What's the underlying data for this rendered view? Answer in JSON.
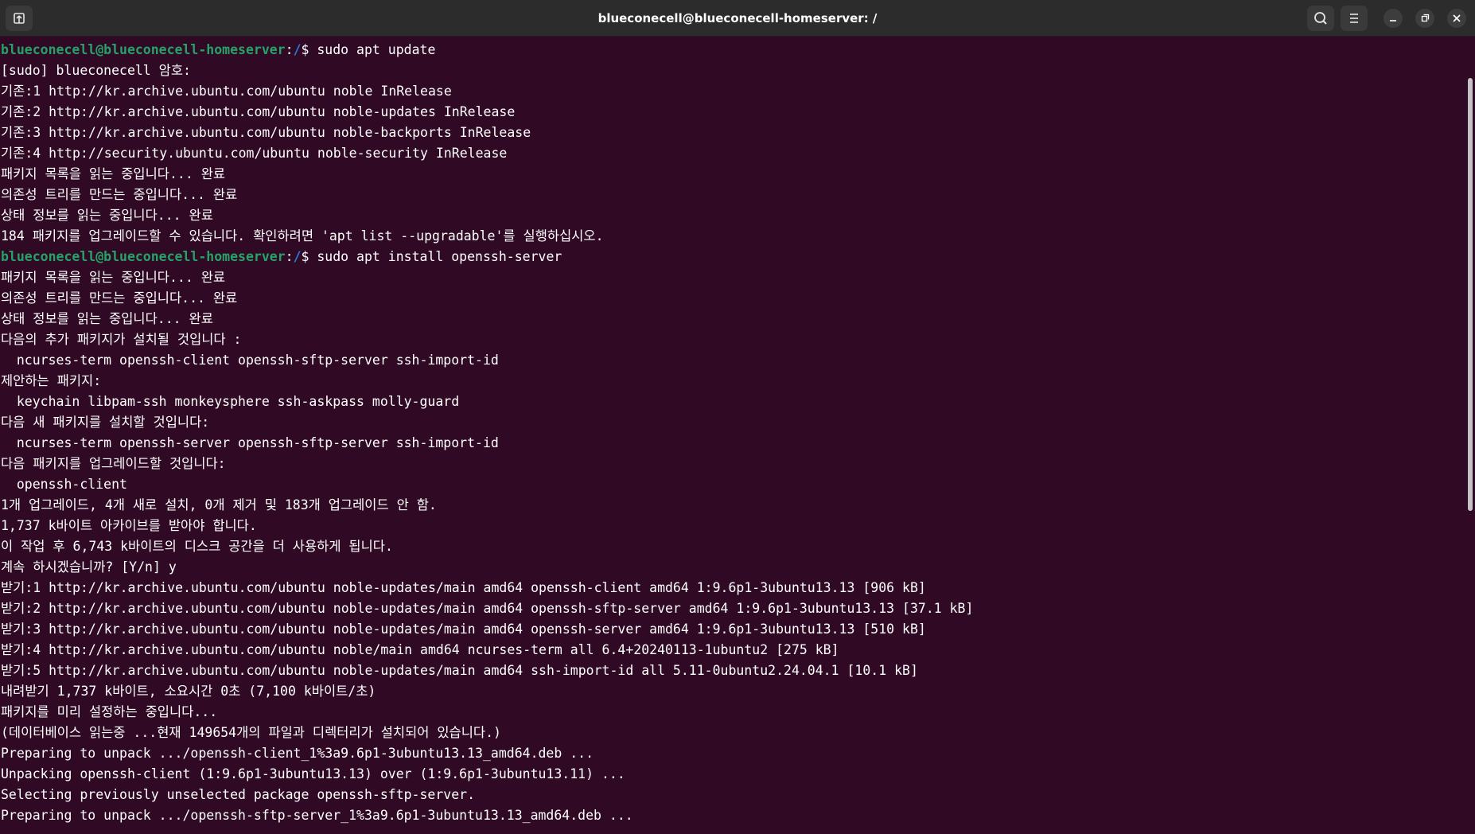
{
  "window": {
    "title": "blueconecell@blueconecell-homeserver: /"
  },
  "icons": {
    "new_tab": "new-tab-icon",
    "search": "search-icon",
    "menu": "hamburger-menu-icon",
    "minimize": "minimize-icon",
    "maximize": "maximize-icon",
    "close": "close-icon"
  },
  "colors": {
    "background": "#300a24",
    "prompt_user": "#26a269",
    "prompt_path": "#2a7bde",
    "text": "#ffffff"
  },
  "terminal": {
    "lines": [
      {
        "prompt": true,
        "user": "blueconecell@blueconecell-homeserver",
        "sep": ":",
        "path": "/",
        "cmd": "$ sudo apt update"
      },
      {
        "text": "[sudo] blueconecell 암호:"
      },
      {
        "text": "기존:1 http://kr.archive.ubuntu.com/ubuntu noble InRelease"
      },
      {
        "text": "기존:2 http://kr.archive.ubuntu.com/ubuntu noble-updates InRelease"
      },
      {
        "text": "기존:3 http://kr.archive.ubuntu.com/ubuntu noble-backports InRelease"
      },
      {
        "text": "기존:4 http://security.ubuntu.com/ubuntu noble-security InRelease"
      },
      {
        "text": "패키지 목록을 읽는 중입니다... 완료"
      },
      {
        "text": "의존성 트리를 만드는 중입니다... 완료"
      },
      {
        "text": "상태 정보를 읽는 중입니다... 완료"
      },
      {
        "text": "184 패키지를 업그레이드할 수 있습니다. 확인하려면 'apt list --upgradable'를 실행하십시오."
      },
      {
        "prompt": true,
        "user": "blueconecell@blueconecell-homeserver",
        "sep": ":",
        "path": "/",
        "cmd": "$ sudo apt install openssh-server"
      },
      {
        "text": "패키지 목록을 읽는 중입니다... 완료"
      },
      {
        "text": "의존성 트리를 만드는 중입니다... 완료"
      },
      {
        "text": "상태 정보를 읽는 중입니다... 완료"
      },
      {
        "text": "다음의 추가 패키지가 설치될 것입니다 :"
      },
      {
        "text": "  ncurses-term openssh-client openssh-sftp-server ssh-import-id"
      },
      {
        "text": "제안하는 패키지:"
      },
      {
        "text": "  keychain libpam-ssh monkeysphere ssh-askpass molly-guard"
      },
      {
        "text": "다음 새 패키지를 설치할 것입니다:"
      },
      {
        "text": "  ncurses-term openssh-server openssh-sftp-server ssh-import-id"
      },
      {
        "text": "다음 패키지를 업그레이드할 것입니다:"
      },
      {
        "text": "  openssh-client"
      },
      {
        "text": "1개 업그레이드, 4개 새로 설치, 0개 제거 및 183개 업그레이드 안 함."
      },
      {
        "text": "1,737 k바이트 아카이브를 받아야 합니다."
      },
      {
        "text": "이 작업 후 6,743 k바이트의 디스크 공간을 더 사용하게 됩니다."
      },
      {
        "text": "계속 하시겠습니까? [Y/n] y"
      },
      {
        "text": "받기:1 http://kr.archive.ubuntu.com/ubuntu noble-updates/main amd64 openssh-client amd64 1:9.6p1-3ubuntu13.13 [906 kB]"
      },
      {
        "text": "받기:2 http://kr.archive.ubuntu.com/ubuntu noble-updates/main amd64 openssh-sftp-server amd64 1:9.6p1-3ubuntu13.13 [37.1 kB]"
      },
      {
        "text": "받기:3 http://kr.archive.ubuntu.com/ubuntu noble-updates/main amd64 openssh-server amd64 1:9.6p1-3ubuntu13.13 [510 kB]"
      },
      {
        "text": "받기:4 http://kr.archive.ubuntu.com/ubuntu noble/main amd64 ncurses-term all 6.4+20240113-1ubuntu2 [275 kB]"
      },
      {
        "text": "받기:5 http://kr.archive.ubuntu.com/ubuntu noble-updates/main amd64 ssh-import-id all 5.11-0ubuntu2.24.04.1 [10.1 kB]"
      },
      {
        "text": "내려받기 1,737 k바이트, 소요시간 0초 (7,100 k바이트/초)"
      },
      {
        "text": "패키지를 미리 설정하는 중입니다..."
      },
      {
        "text": "(데이터베이스 읽는중 ...현재 149654개의 파일과 디렉터리가 설치되어 있습니다.)"
      },
      {
        "text": "Preparing to unpack .../openssh-client_1%3a9.6p1-3ubuntu13.13_amd64.deb ..."
      },
      {
        "text": "Unpacking openssh-client (1:9.6p1-3ubuntu13.13) over (1:9.6p1-3ubuntu13.11) ..."
      },
      {
        "text": "Selecting previously unselected package openssh-sftp-server."
      },
      {
        "text": "Preparing to unpack .../openssh-sftp-server_1%3a9.6p1-3ubuntu13.13_amd64.deb ..."
      }
    ]
  }
}
